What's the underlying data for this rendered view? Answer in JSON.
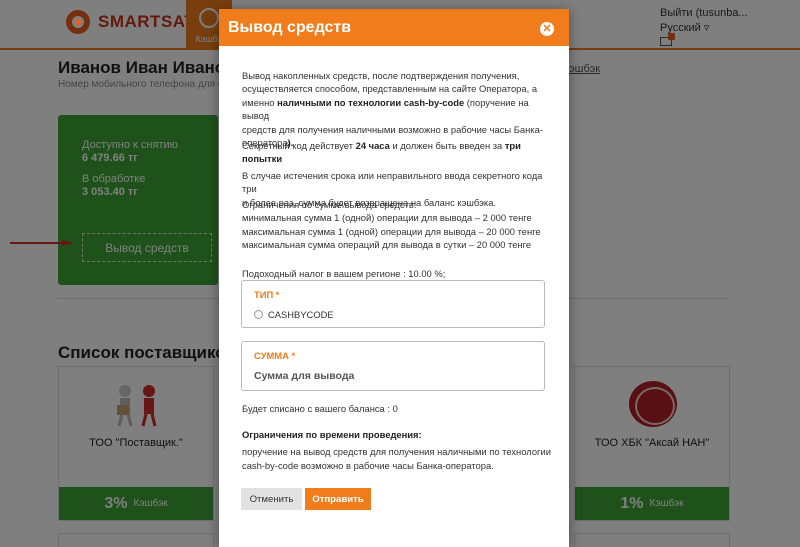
{
  "header": {
    "brand": "SMARTSATU",
    "tab_label": "Кэшбэ",
    "logout": "Выйти (tusunba...",
    "language": "Русский ▿"
  },
  "profile": {
    "name": "Иванов Иван Иванович",
    "subtitle": "Номер мобильного телефона для С",
    "right_link": "эшбэк"
  },
  "balance_card": {
    "available_label": "Доступно к снятию",
    "available_value": "6 479.66 тг",
    "processing_label": "В обработке",
    "processing_value": "3 053.40 тг",
    "withdraw_button": "Вывод средств"
  },
  "suppliers": {
    "title": "Список поставщиков",
    "items": [
      {
        "name": "ТОО \"Поставщик.\"",
        "cashback": "3%",
        "cashback_label": "Кэшбэк"
      },
      {
        "name": "ТОО ХБК \"Аксай НАН\"",
        "cashback": "1%",
        "cashback_label": "Кэшбэк"
      }
    ]
  },
  "modal": {
    "title": "Вывод средств",
    "p1_a": "Вывод накопленных средств, после подтверждения получения,",
    "p1_b": "осуществляется способом, представленным на сайте Оператора, а",
    "p1_c1": "именно ",
    "p1_c2": "наличными по технологии cash-by-code",
    "p1_c3": " (поручение на вывод",
    "p1_d": "средств для получения наличными возможно в рабочие часы Банка-",
    "p1_e1": "оператора",
    "p1_e2": ").",
    "p2_a1": "Секретный код действует ",
    "p2_a2": "24 часа",
    "p2_a3": " и должен быть введен за ",
    "p2_a4": "три попытки",
    "p2_b": ".",
    "p3_a": "В случае истечения срока или неправильного ввода секретного кода три",
    "p3_b": "и более раз, сумма будет возвращена на баланс кэшбэка.",
    "limits_title": "Ограничения по сумме вывода средств:",
    "limit_1": "минимальная сумма 1 (одной) операции для вывода – 2 000 тенге",
    "limit_2": "максимальная сумма 1 (одной) операции для вывода – 20 000 тенге",
    "limit_3": "максимальная сумма операций для вывода в сутки – 20 000 тенге",
    "tax": "Подоходный налог в вашем регионе : 10.00 %;",
    "type_label": "ТИП *",
    "type_option": "CASHBYCODE",
    "amount_label": "СУММА *",
    "amount_placeholder": "Сумма для вывода",
    "debited": "Будет списано с вашего баланса : 0",
    "time_limits_title": "Ограничения по времени проведения:",
    "time_limits_a": "поручение на вывод средств для получения наличными по технологии",
    "time_limits_b": "cash-by-code возможно в рабочие часы Банка-оператора.",
    "cancel_button": "Отменить",
    "submit_button": "Отправить"
  },
  "colors": {
    "accent": "#f07c1b",
    "green": "#3fa535",
    "brand_red": "#c6331a",
    "arrow_red": "#d42a2a"
  },
  "icons": [
    "logo-icon",
    "cashback-tab-icon",
    "mail-icon",
    "close-icon",
    "radio-icon",
    "arrow-icon"
  ]
}
